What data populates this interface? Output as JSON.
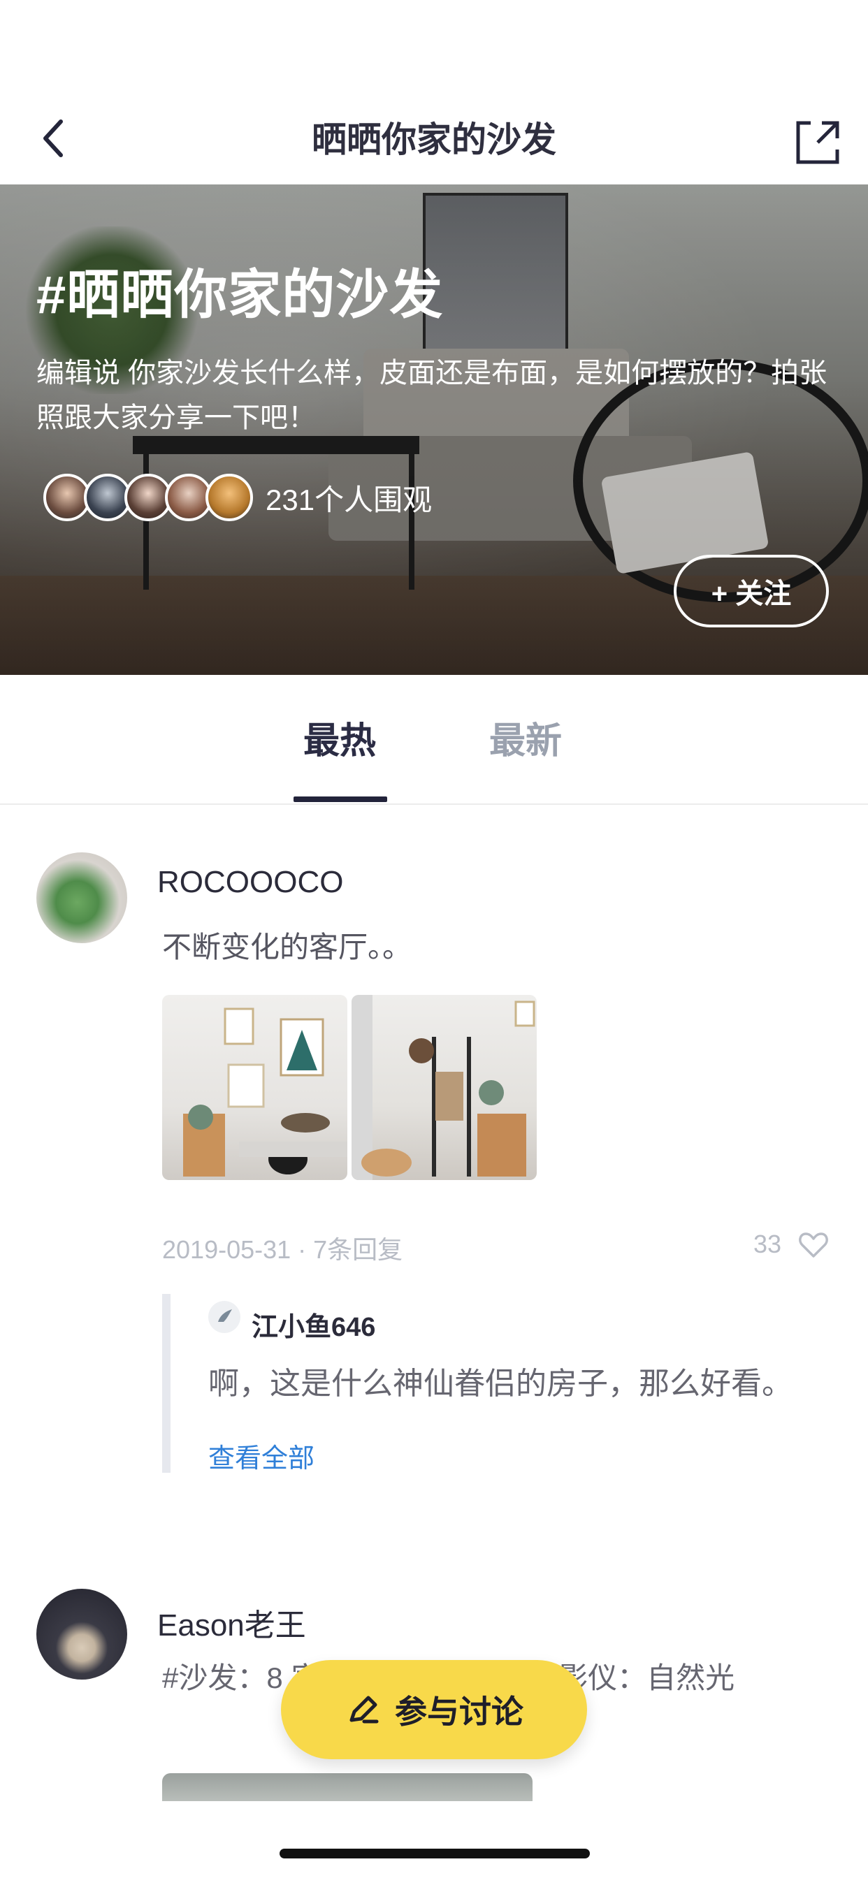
{
  "nav": {
    "title": "晒晒你家的沙发",
    "back_icon": "chevron-left-icon",
    "share_icon": "share-icon"
  },
  "hero": {
    "title": "#晒晒你家的沙发",
    "description": "编辑说 你家沙发长什么样，皮面还是布面，是如何摆放的？拍张照跟大家分享一下吧！",
    "watch_count": "231个人围观",
    "follow_label": "+ 关注"
  },
  "tabs": [
    {
      "label": "最热",
      "active": true
    },
    {
      "label": "最新",
      "active": false
    }
  ],
  "posts": [
    {
      "author": "ROCOOOCO",
      "text": "不断变化的客厅。。",
      "meta": "2019-05-31 · 7条回复",
      "likes": "33",
      "reply": {
        "author": "江小鱼646",
        "text": "啊，这是什么神仙眷侣的房子，那么好看。",
        "more_label": "查看全部"
      }
    },
    {
      "author": "Eason老王",
      "text": "#沙发：8 家 #靠枕：nitori # 投影仪：自然光"
    }
  ],
  "fab": {
    "label": "参与讨论",
    "icon": "pen-icon",
    "color": "#f8d94a"
  },
  "colors": {
    "accent_link": "#2f7fd8",
    "tab_active": "#22233a",
    "tab_inactive": "#9aa1ae"
  }
}
